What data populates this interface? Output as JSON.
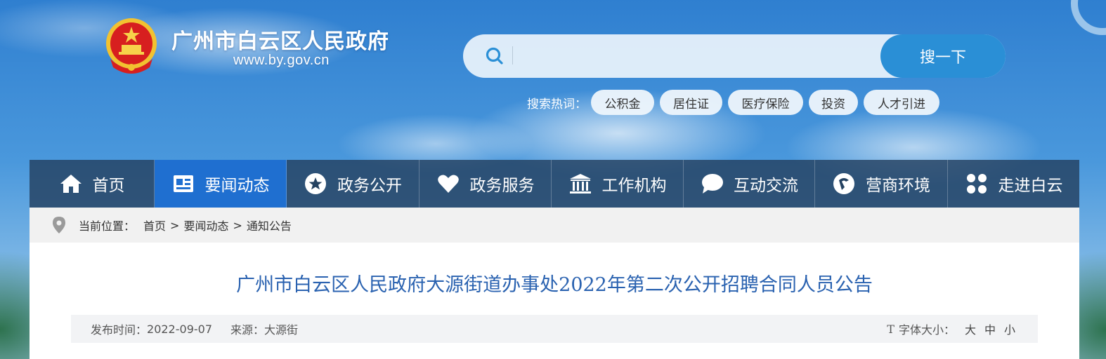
{
  "header": {
    "site_title": "广州市白云区人民政府",
    "site_url": "www.by.gov.cn"
  },
  "search": {
    "placeholder": "",
    "button_label": "搜一下",
    "hot_label": "搜索热词：",
    "hot_tags": [
      "公积金",
      "居住证",
      "医疗保险",
      "投资",
      "人才引进"
    ]
  },
  "nav": {
    "items": [
      {
        "label": "首页",
        "icon": "home-icon"
      },
      {
        "label": "要闻动态",
        "icon": "news-icon"
      },
      {
        "label": "政务公开",
        "icon": "star-icon"
      },
      {
        "label": "政务服务",
        "icon": "heart-icon"
      },
      {
        "label": "工作机构",
        "icon": "building-icon"
      },
      {
        "label": "互动交流",
        "icon": "chat-icon"
      },
      {
        "label": "营商环境",
        "icon": "business-icon"
      },
      {
        "label": "走进白云",
        "icon": "clover-icon"
      }
    ],
    "active_index": 1
  },
  "breadcrumb": {
    "label": "当前位置：",
    "items": [
      "首页",
      "要闻动态",
      "通知公告"
    ],
    "separator": ">"
  },
  "article": {
    "title": "广州市白云区人民政府大源街道办事处2022年第二次公开招聘合同人员公告",
    "publish_label": "发布时间：",
    "publish_date": "2022-09-07",
    "source_label": "来源：",
    "source": "大源街",
    "font_size_icon": "T",
    "font_size_label": "字体大小：",
    "font_sizes": [
      "大",
      "中",
      "小"
    ]
  },
  "colors": {
    "nav_bg": "#244160",
    "nav_active": "#1f6fd0",
    "search_button": "#2a8fd6",
    "title_blue": "#2a62b0"
  }
}
